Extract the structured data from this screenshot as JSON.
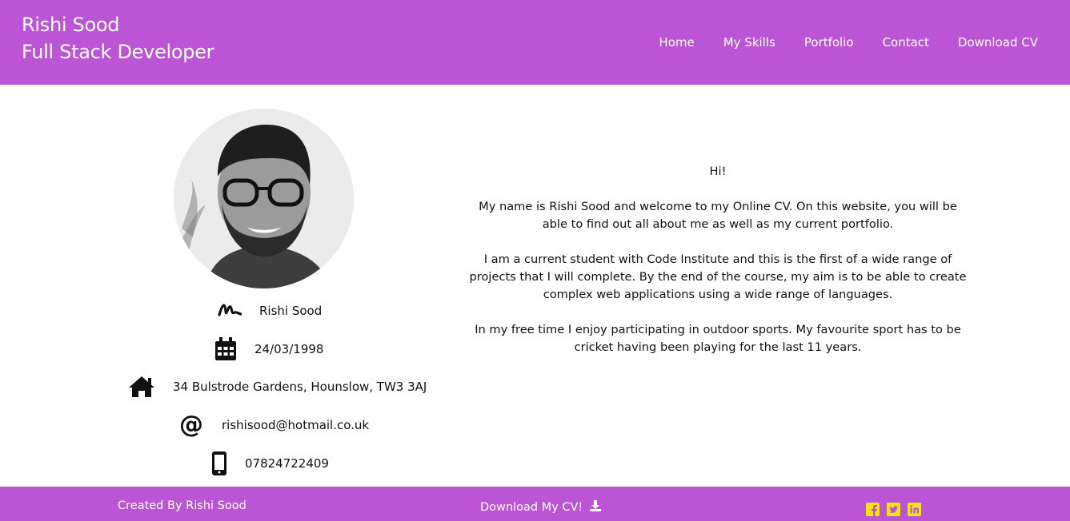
{
  "header": {
    "name": "Rishi Sood",
    "role": "Full Stack Developer",
    "nav": [
      "Home",
      "My Skills",
      "Portfolio",
      "Contact",
      "Download CV"
    ]
  },
  "profile": {
    "photo_icon": "profile-photo",
    "name": "Rishi Sood",
    "dob": "24/03/1998",
    "address": "34 Bulstrode Gardens, Hounslow, TW3 3AJ",
    "email": "rishisood@hotmail.co.uk",
    "phone": "07824722409",
    "icons": [
      "signature-icon",
      "calendar-icon",
      "home-icon",
      "at-icon",
      "mobile-phone-icon"
    ]
  },
  "intro": {
    "greeting": "Hi!",
    "p1": "My name is Rishi Sood and welcome to my Online CV. On this website, you will be able to find out all about me as well as my current portfolio.",
    "p2": "I am a current student with Code Institute and this is the first of a wide range of projects that I will complete. By the end of the course, my aim is to be able to create complex web applications using a wide range of languages.",
    "p3": "In my free time I enjoy participating in outdoor sports. My favourite sport has to be cricket having been playing for the last 11 years."
  },
  "footer": {
    "credit": "Created By Rishi Sood",
    "download": "Download My CV!",
    "social_icons": [
      "facebook-icon",
      "twitter-icon",
      "linkedin-icon"
    ],
    "social_color": "#f7e11b"
  },
  "colors": {
    "accent": "#bb55d6",
    "text": "#111111"
  }
}
